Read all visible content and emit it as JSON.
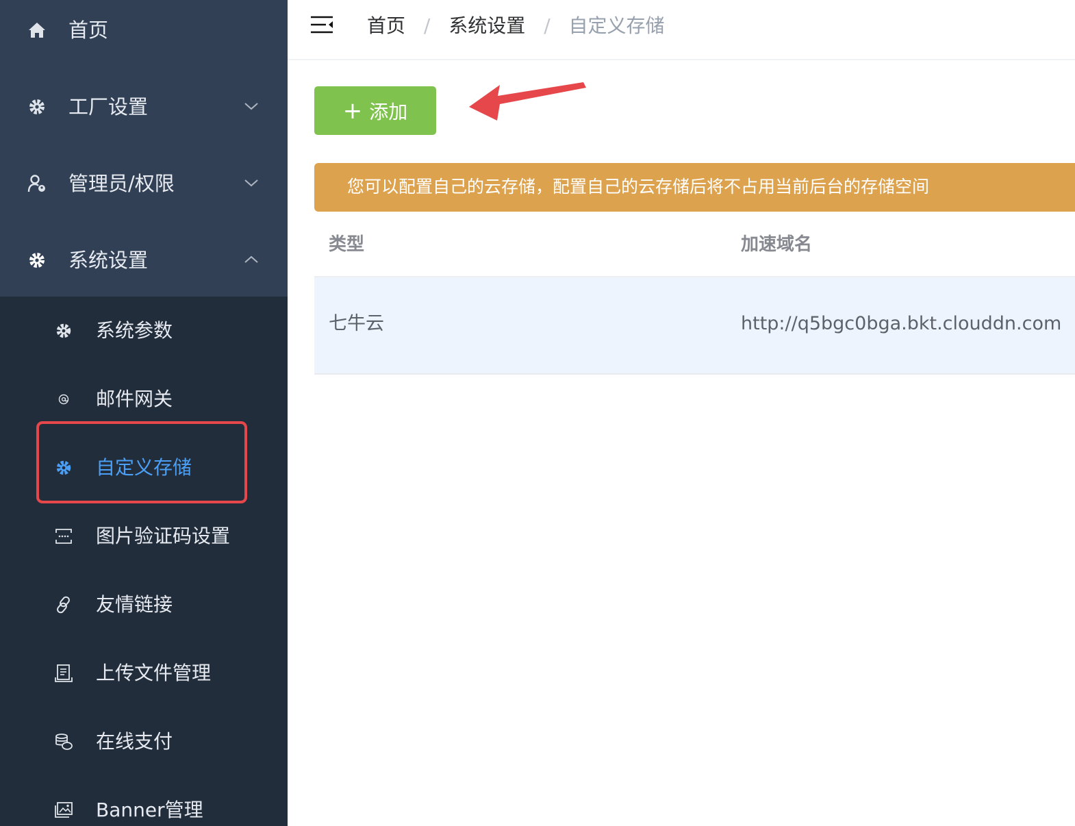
{
  "sidebar": {
    "top_items": [
      {
        "label": "首页",
        "icon": "home-icon",
        "chevron": "none"
      },
      {
        "label": "工厂设置",
        "icon": "gear-icon",
        "chevron": "down"
      },
      {
        "label": "管理员/权限",
        "icon": "user-key-icon",
        "chevron": "down"
      },
      {
        "label": "系统设置",
        "icon": "gear-icon",
        "chevron": "up"
      }
    ],
    "sub_items": [
      {
        "label": "系统参数",
        "icon": "gear-icon"
      },
      {
        "label": "邮件网关",
        "icon": "at-icon"
      },
      {
        "label": "自定义存储",
        "icon": "gear-icon",
        "active": true
      },
      {
        "label": "图片验证码设置",
        "icon": "captcha-icon"
      },
      {
        "label": "友情链接",
        "icon": "link-icon"
      },
      {
        "label": "上传文件管理",
        "icon": "file-manage-icon"
      },
      {
        "label": "在线支付",
        "icon": "coins-icon"
      },
      {
        "label": "Banner管理",
        "icon": "image-icon"
      }
    ]
  },
  "header": {
    "breadcrumb": [
      "首页",
      "系统设置",
      "自定义存储"
    ],
    "separator": "/"
  },
  "toolbar": {
    "add_plus": "+",
    "add_label": "添加"
  },
  "alert": {
    "text": "您可以配置自己的云存储，配置自己的云存储后将不占用当前后台的存储空间"
  },
  "table": {
    "columns": [
      "类型",
      "加速域名"
    ],
    "rows": [
      [
        "七牛云",
        "http://q5bgc0bga.bkt.clouddn.com"
      ]
    ]
  },
  "colors": {
    "sidebar_bg": "#222d3c",
    "sidebar_top_bg": "#314054",
    "active_text": "#4b9ff5",
    "add_button": "#7fc24d",
    "alert_bg": "#dda24d",
    "annotation_red": "#e5474a",
    "row_highlight": "#edf4fe"
  }
}
